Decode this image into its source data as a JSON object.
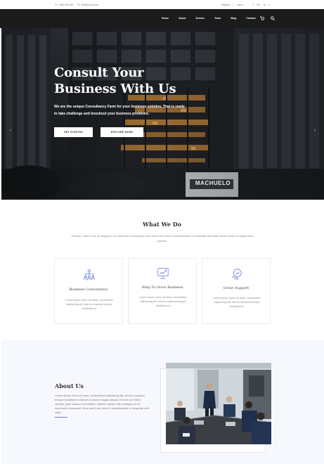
{
  "topbar": {
    "phone": "+880 953 542",
    "email": "info@yoobi.com",
    "register": "Register",
    "separator": "|",
    "login": "Log In",
    "social_icons": [
      "facebook-icon",
      "google-plus-icon",
      "linkedin-icon",
      "twitter-icon"
    ]
  },
  "nav": {
    "items": [
      "Home",
      "About",
      "Service",
      "Team",
      "Blog",
      "Contact"
    ],
    "cart_icon": "cart-icon",
    "search_icon": "search-icon"
  },
  "hero": {
    "title_line1": "Consult Your",
    "title_line2": "Business With Us",
    "subtitle_line1": "We are the unique Consultancy Farm for your business solution, That is ready",
    "subtitle_line2": "to take challenge and knockout your business problems.",
    "primary_button": "GET STARTED",
    "secondary_button": "EXPLORE MORE",
    "building_sign": "MACHUELO",
    "prev_icon": "chevron-left-icon",
    "next_icon": "chevron-right-icon"
  },
  "services": {
    "title": "What We Do",
    "subtitle": "Pariatur, odorro has un aliquip ex ea commodo consequat. Duis aute irure dolor in reprehenderit in voluptate velit esse cillum dolore eu fugiat nulla pariatur.",
    "cards": [
      {
        "icon": "team-structure-icon",
        "title": "Business Consultancy",
        "text": "Lorem ipsum dolor sit amet, consectetur adipisicing elit, sed do eiusmod tempor incididunt ut"
      },
      {
        "icon": "growth-chart-icon",
        "title": "Help To Grow Business",
        "text": "Lorem ipsum dolor sit amet, consectetur adipisicing elit, sed do eiusmod tempor incididunt ut"
      },
      {
        "icon": "support-hand-icon",
        "title": "Great Support",
        "text": "Lorem ipsum dolor sit amet, consectetur adipisicing elit, sed do eiusmod tempor incididunt ut"
      }
    ]
  },
  "about": {
    "title": "About Us",
    "text": "Lorem ipsum dolor sit amet, consectetur adipisicing elit, sed do eiusmod tempor incididunt ut labore et dolore magna aliqua. Ut enim ad minim veniam, quis nostrud exercitation ullamco laboris nisi ut aliquip ex ea commodo consequat. Duis aute irure dolor in reprehenderit in voluptate velit esse."
  },
  "colors": {
    "nav_bg": "#1b1b1b",
    "accent": "#6b7bd8",
    "about_bg": "#f7f8fd"
  }
}
